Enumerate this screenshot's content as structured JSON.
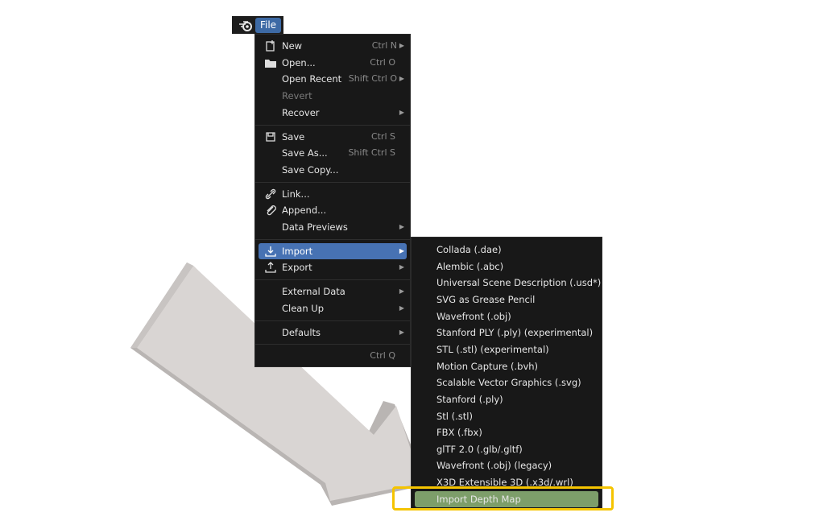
{
  "topbar": {
    "file_label": "File",
    "logo_icon": "blender-logo-icon"
  },
  "file_menu": {
    "groups": [
      [
        {
          "label": "New",
          "shortcut": "Ctrl N",
          "submenu": true,
          "icon": "new-file-icon"
        },
        {
          "label": "Open...",
          "shortcut": "Ctrl O",
          "icon": "folder-icon"
        },
        {
          "label": "Open Recent",
          "shortcut": "Shift Ctrl O",
          "submenu": true
        },
        {
          "label": "Revert",
          "disabled": true
        },
        {
          "label": "Recover",
          "submenu": true
        }
      ],
      [
        {
          "label": "Save",
          "shortcut": "Ctrl S",
          "icon": "save-icon"
        },
        {
          "label": "Save As...",
          "shortcut": "Shift Ctrl S"
        },
        {
          "label": "Save Copy..."
        }
      ],
      [
        {
          "label": "Link...",
          "icon": "link-icon"
        },
        {
          "label": "Append...",
          "icon": "paperclip-icon"
        },
        {
          "label": "Data Previews",
          "submenu": true
        }
      ],
      [
        {
          "label": "Import",
          "submenu": true,
          "active": true,
          "icon": "import-icon"
        },
        {
          "label": "Export",
          "submenu": true,
          "icon": "export-icon"
        }
      ],
      [
        {
          "label": "External Data",
          "submenu": true
        },
        {
          "label": "Clean Up",
          "submenu": true
        }
      ],
      [
        {
          "label": "Defaults",
          "submenu": true
        }
      ],
      [
        {
          "label": "",
          "shortcut": "Ctrl Q"
        }
      ]
    ]
  },
  "import_menu": {
    "items": [
      "Collada (.dae)",
      "Alembic (.abc)",
      "Universal Scene Description (.usd*)",
      "SVG as Grease Pencil",
      "Wavefront (.obj)",
      "Stanford PLY (.ply) (experimental)",
      "STL (.stl) (experimental)",
      "Motion Capture (.bvh)",
      "Scalable Vector Graphics (.svg)",
      "Stanford (.ply)",
      "Stl (.stl)",
      "FBX (.fbx)",
      "glTF 2.0 (.glb/.gltf)",
      "Wavefront (.obj) (legacy)",
      "X3D Extensible 3D (.x3d/.wrl)",
      "Import Depth Map"
    ],
    "highlighted_index": 15
  },
  "colors": {
    "menu_bg": "#181818",
    "active_bg": "#4772b3",
    "highlight_bg": "#7d9e6a",
    "highlight_frame": "#f5c400",
    "arrow": "#dcd8d6"
  }
}
